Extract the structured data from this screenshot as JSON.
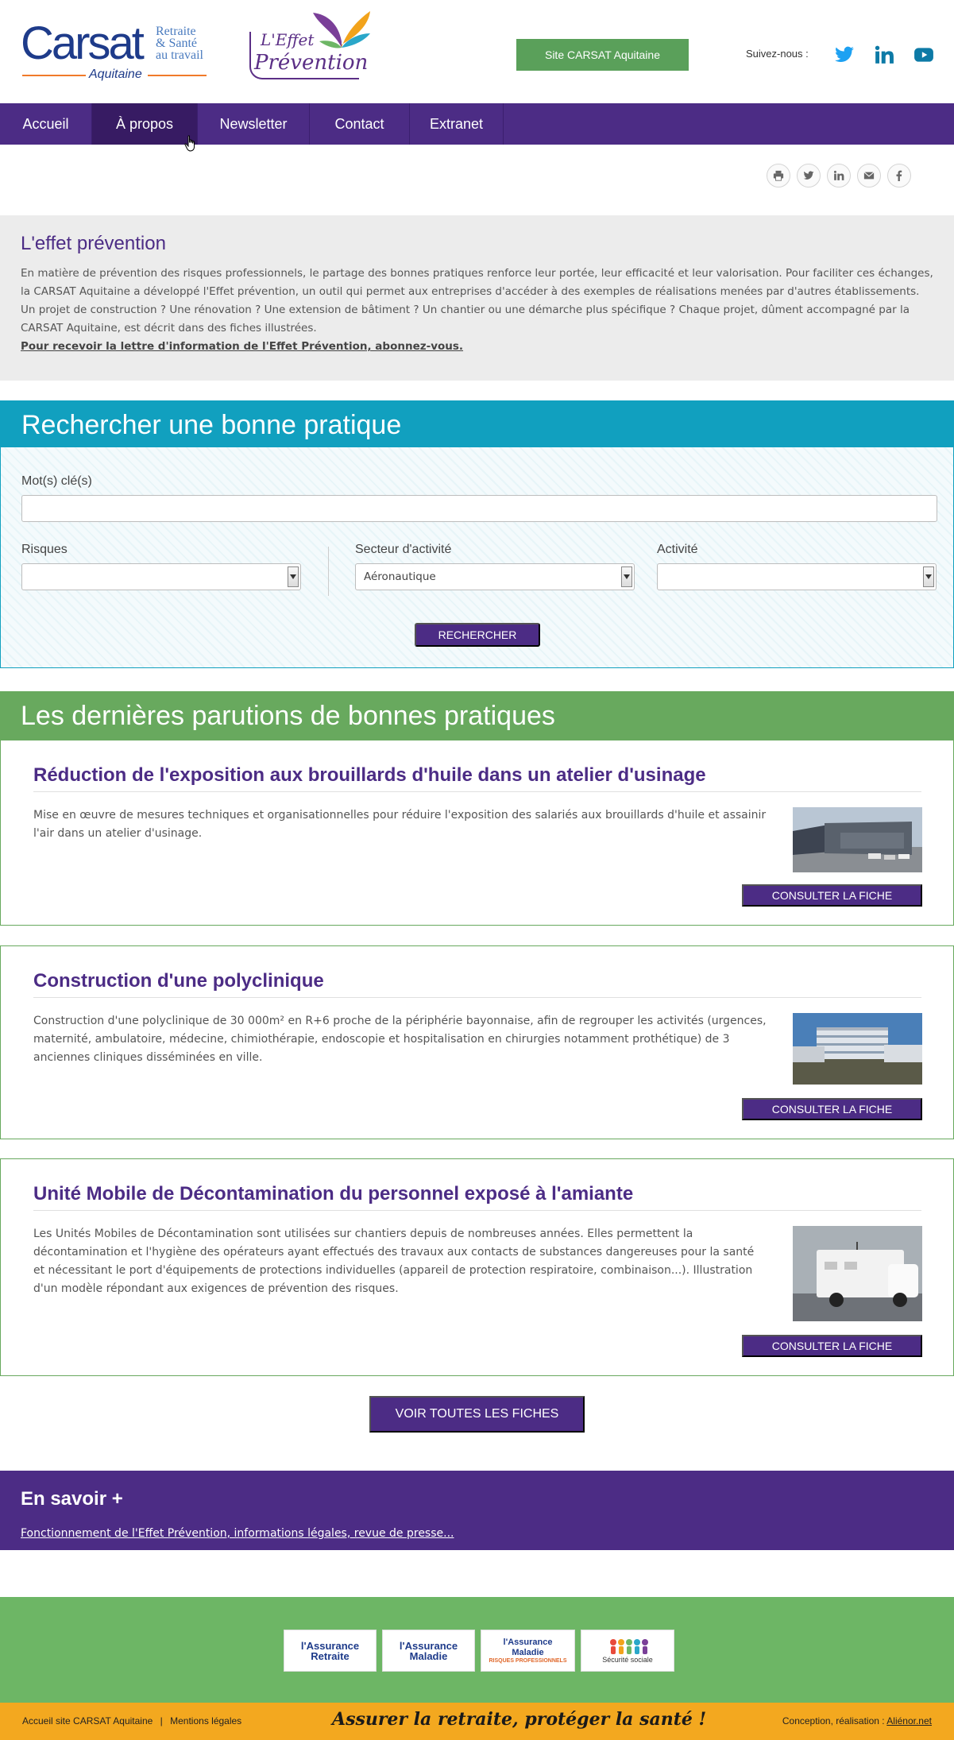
{
  "header": {
    "carsat_logo": {
      "word": "Carsat",
      "tagline_1": "Retraite",
      "tagline_2": "& Santé",
      "tagline_3": "au travail",
      "region": "Aquitaine"
    },
    "effet_logo": {
      "line1": "L'Effet",
      "line2": "Prévention"
    },
    "site_button": "Site CARSAT Aquitaine",
    "follow_label": "Suivez-nous :",
    "social": [
      "twitter-icon",
      "linkedin-icon",
      "youtube-icon"
    ],
    "colors": {
      "carsat_blue": "#1e3b8a",
      "accent_orange": "#f07a2a",
      "brand_purple": "#4c2c85",
      "green": "#5aa05a"
    }
  },
  "nav": {
    "items": [
      {
        "label": "Accueil",
        "active": false
      },
      {
        "label": "À propos",
        "active": true
      },
      {
        "label": "Newsletter",
        "active": false
      },
      {
        "label": "Contact",
        "active": false
      },
      {
        "label": "Extranet",
        "active": false
      }
    ]
  },
  "share": [
    "print-icon",
    "twitter-icon",
    "linkedin-icon",
    "mail-icon",
    "facebook-icon"
  ],
  "intro": {
    "title": "L'effet prévention",
    "text": "En matière de prévention des risques professionnels, le partage des bonnes pratiques renforce leur portée, leur efficacité et leur valorisation. Pour faciliter ces échanges, la CARSAT Aquitaine a développé l'Effet prévention, un outil qui permet aux entreprises d'accéder à des exemples de réalisations menées par d'autres établissements. Un projet de construction ? Une rénovation ? Une extension de bâtiment ? Un chantier ou une démarche plus spécifique ? Chaque projet, dûment accompagné par la CARSAT Aquitaine, est décrit dans des fiches illustrées.",
    "link": "Pour recevoir la lettre d'information de l'Effet Prévention, abonnez-vous."
  },
  "search": {
    "title": "Rechercher une bonne pratique",
    "keywords_label": "Mot(s) clé(s)",
    "keywords_value": "",
    "risques_label": "Risques",
    "risques_value": "",
    "secteur_label": "Secteur d'activité",
    "secteur_value": "Aéronautique",
    "activite_label": "Activité",
    "activite_value": "",
    "button": "RECHERCHER"
  },
  "latest": {
    "title": "Les dernières parutions de bonnes pratiques",
    "cards": [
      {
        "title": "Réduction de l'exposition aux brouillards d'huile dans un atelier d'usinage",
        "description": "Mise en œuvre de mesures techniques et organisationnelles pour réduire l'exposition des salariés aux brouillards d'huile et assainir l'air dans un atelier d'usinage.",
        "button": "CONSULTER LA FICHE"
      },
      {
        "title": "Construction d'une polyclinique",
        "description": "Construction d'une polyclinique de 30 000m² en R+6 proche de la périphérie bayonnaise, afin de regrouper les activités (urgences, maternité, ambulatoire, médecine, chimiothérapie, endoscopie et hospitalisation en chirurgies notamment prothétique) de 3 anciennes cliniques disséminées en ville.",
        "button": "CONSULTER LA FICHE"
      },
      {
        "title": "Unité Mobile de Décontamination du personnel exposé à l'amiante",
        "description": "Les Unités Mobiles de Décontamination sont utilisées sur chantiers depuis de nombreuses années. Elles permettent la décontamination et l'hygiène des opérateurs ayant effectués des travaux aux contacts de substances dangereuses pour la santé et nécessitant le port d'équipements de protections individuelles (appareil de protection respiratoire, combinaison...). Illustration d'un modèle répondant aux exigences de prévention des risques.",
        "button": "CONSULTER LA FICHE"
      }
    ],
    "all_button": "VOIR TOUTES LES FICHES"
  },
  "savoir": {
    "title": "En savoir +",
    "link": "Fonctionnement de l'Effet Prévention, informations légales, revue de presse..."
  },
  "partners": [
    {
      "main": "l'Assurance\nRetraite",
      "sub": ""
    },
    {
      "main": "l'Assurance\nMaladie",
      "sub": ""
    },
    {
      "main": "l'Assurance\nMaladie",
      "sub": "RISQUES PROFESSIONNELS"
    },
    {
      "main": "Sécurité sociale",
      "sub": ""
    }
  ],
  "footer": {
    "left_link_1": "Accueil site CARSAT Aquitaine",
    "separator": "|",
    "left_link_2": "Mentions légales",
    "slogan": "Assurer la retraite, protéger la santé !",
    "credit_label": "Conception, réalisation :",
    "credit_link": "Aliénor.net"
  }
}
